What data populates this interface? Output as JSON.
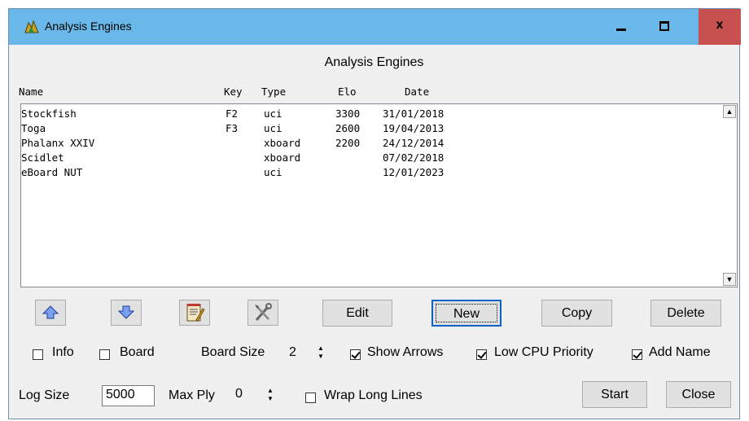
{
  "window": {
    "title": "Analysis Engines",
    "heading": "Analysis Engines",
    "minimize_glyph": "",
    "maximize_glyph": "",
    "close_glyph": "x"
  },
  "columns": {
    "name": "Name",
    "key": "Key",
    "type": "Type",
    "elo": "Elo",
    "date": "Date"
  },
  "engines": [
    {
      "name": "Stockfish",
      "key": "F2",
      "type": "uci",
      "elo": "3300",
      "date": "31/01/2018"
    },
    {
      "name": "Toga",
      "key": "F3",
      "type": "uci",
      "elo": "2600",
      "date": "19/04/2013"
    },
    {
      "name": "Phalanx XXIV",
      "key": "",
      "type": "xboard",
      "elo": "2200",
      "date": "24/12/2014"
    },
    {
      "name": "Scidlet",
      "key": "",
      "type": "xboard",
      "elo": "",
      "date": "07/02/2018"
    },
    {
      "name": "eBoard NUT",
      "key": "",
      "type": "uci",
      "elo": "",
      "date": "12/01/2023"
    }
  ],
  "buttons": {
    "edit": "Edit",
    "new": "New",
    "copy": "Copy",
    "delete": "Delete",
    "start": "Start",
    "close": "Close"
  },
  "options": {
    "info": {
      "label": "Info",
      "checked": false
    },
    "board": {
      "label": "Board",
      "checked": false
    },
    "board_size_label": "Board Size",
    "board_size_value": "2",
    "show_arrows": {
      "label": "Show Arrows",
      "checked": true
    },
    "low_cpu": {
      "label": "Low CPU Priority",
      "checked": true
    },
    "add_name": {
      "label": "Add Name",
      "checked": true
    },
    "log_size_label": "Log Size",
    "log_size_value": "5000",
    "max_ply_label": "Max Ply",
    "max_ply_value": "0",
    "wrap_lines": {
      "label": "Wrap Long Lines",
      "checked": false
    }
  },
  "icons": {
    "move_up": "arrow-up-icon",
    "move_down": "arrow-down-icon",
    "edit_config": "notepad-icon",
    "configure": "tools-icon"
  },
  "colors": {
    "titlebar": "#69b8e9",
    "close_button": "#c75050",
    "default_button_border": "#0a64c8",
    "up_arrow": "#7b9ff0"
  }
}
